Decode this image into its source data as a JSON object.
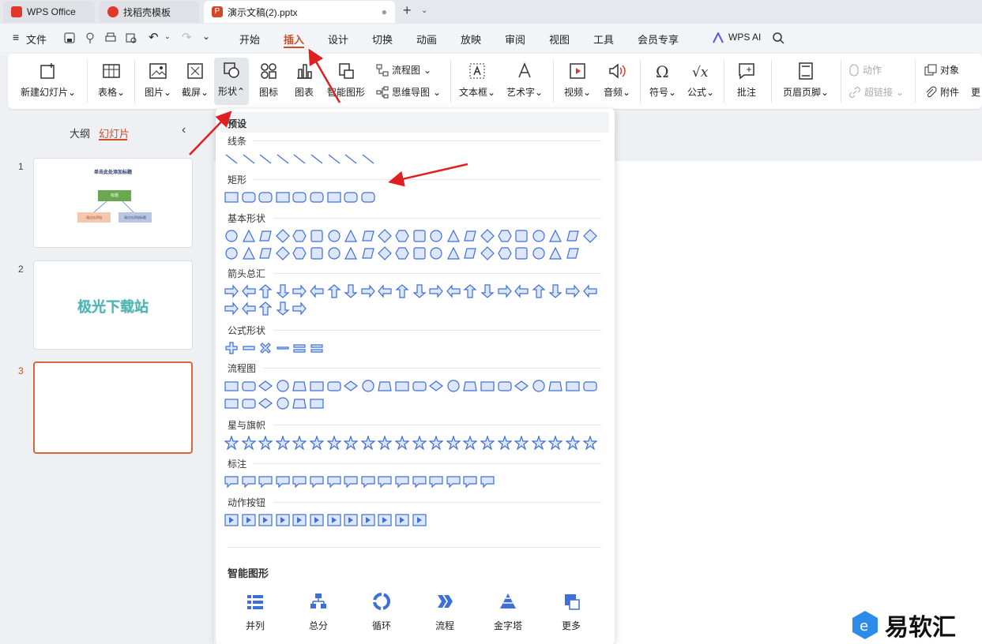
{
  "tabs": [
    {
      "label": "WPS Office"
    },
    {
      "label": "找稻壳模板"
    },
    {
      "label": "演示文稿(2).pptx"
    }
  ],
  "menubar": {
    "file_label": "文件",
    "tabs": [
      "开始",
      "插入",
      "设计",
      "切换",
      "动画",
      "放映",
      "审阅",
      "视图",
      "工具",
      "会员专享"
    ],
    "active_tab": "插入",
    "wps_ai_label": "WPS AI"
  },
  "ribbon": {
    "new_slide": "新建幻灯片",
    "table": "表格",
    "picture": "图片",
    "screenshot": "截屏",
    "shape": "形状",
    "icon": "图标",
    "chart": "图表",
    "smart_art": "智能图形",
    "flowchart": "流程图",
    "mindmap": "思维导图",
    "textbox": "文本框",
    "wordart": "艺术字",
    "video": "视频",
    "audio": "音频",
    "symbol": "符号",
    "formula": "公式",
    "comment": "批注",
    "header_footer": "页眉页脚",
    "action": "动作",
    "hyperlink": "超链接",
    "object": "对象",
    "attachment": "附件",
    "more": "更"
  },
  "left_pane": {
    "outline_tab": "大纲",
    "slides_tab": "幻灯片",
    "slides": [
      {
        "number": "1",
        "title": "单击此处添加标题",
        "box_top": "标题",
        "box_left": "请点击添加",
        "box_right": "请点击添加标题"
      },
      {
        "number": "2",
        "text": "极光下载站"
      },
      {
        "number": "3"
      }
    ]
  },
  "shape_menu": {
    "header": "预设",
    "sections": [
      "线条",
      "矩形",
      "基本形状",
      "箭头总汇",
      "公式形状",
      "流程图",
      "星与旗帜",
      "标注",
      "动作按钮"
    ],
    "smart_header": "智能图形",
    "smart_items": [
      "并列",
      "总分",
      "循环",
      "流程",
      "金字塔",
      "更多"
    ]
  },
  "watermark": {
    "text": "易软汇"
  },
  "colors": {
    "accent": "#c8512a",
    "wps_red": "#e0392b",
    "shape_blue": "#3d6fd8",
    "arrow_red": "#e02020"
  }
}
